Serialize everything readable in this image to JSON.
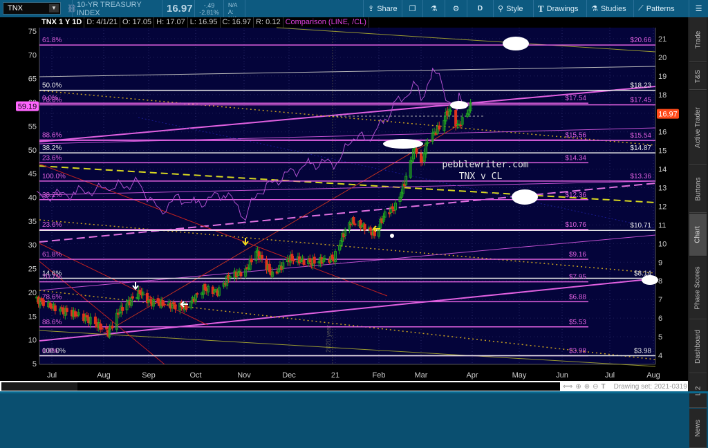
{
  "toolbar": {
    "symbol": "TNX",
    "description": "10-YR TREASURY INDEX",
    "last": "16.97",
    "change": "-.49",
    "change_pct": "-2.81%",
    "bid": "B: N/A",
    "ask": "A: N/A",
    "share": "Share",
    "aggregation": "D",
    "style": "Style",
    "drawings": "Drawings",
    "studies": "Studies",
    "patterns": "Patterns"
  },
  "infobar": {
    "title": "TNX 1 Y 1D",
    "date": "D: 4/1/21",
    "open": "O: 17.05",
    "high": "H: 17.07",
    "low": "L: 16.95",
    "close": "C: 16.97",
    "range": "R: 0.12",
    "comparison": "Comparison (LINE, /CL)"
  },
  "sidebar": {
    "tabs": [
      "Trade",
      "T&S",
      "Active Trader",
      "Buttons",
      "Chart",
      "Phase Scores",
      "Dashboard",
      "L 2",
      "News"
    ],
    "selected": "Chart"
  },
  "drawing_set": "Drawing set: 2021-0319",
  "annotation": {
    "line1": "pebblewriter.com",
    "line2": "TNX v CL",
    "year_marker": "2020 year"
  },
  "colors": {
    "bg": "#04043a",
    "up": "#1fa31f",
    "down": "#e0321e",
    "comparison": "#b050d0",
    "fib": "#e060e0",
    "white": "#e8e8e8",
    "price_badge": "#ff4a1a",
    "comp_badge": "#ff66ff"
  },
  "chart_data": {
    "type": "candlestick",
    "title": "TNX 1 Y 1D",
    "x_ticks": [
      "Jul",
      "Aug",
      "Sep",
      "Oct",
      "Nov",
      "Dec",
      "21",
      "Feb",
      "Mar",
      "Apr",
      "May",
      "Jun",
      "Jul",
      "Aug"
    ],
    "right_axis": {
      "label": "TNX",
      "range": [
        3.5,
        21.5
      ],
      "ticks": [
        4,
        5,
        6,
        7,
        8,
        9,
        10,
        11,
        12,
        13,
        14,
        15,
        16,
        17,
        18,
        19,
        20,
        21
      ]
    },
    "left_axis": {
      "label": "/CL",
      "range": [
        3,
        75
      ],
      "ticks": [
        5,
        10,
        15,
        20,
        25,
        30,
        35,
        40,
        45,
        50,
        55,
        60,
        65,
        70,
        75
      ]
    },
    "last_price": "16.97",
    "comparison_last": "59.19",
    "tnx_close": [
      [
        "2020-06-22",
        7.0
      ],
      [
        "2020-07-01",
        6.6
      ],
      [
        "2020-07-15",
        6.2
      ],
      [
        "2020-07-24",
        5.9
      ],
      [
        "2020-08-04",
        5.2
      ],
      [
        "2020-08-12",
        6.4
      ],
      [
        "2020-08-26",
        7.4
      ],
      [
        "2020-09-01",
        6.9
      ],
      [
        "2020-09-15",
        6.7
      ],
      [
        "2020-09-25",
        6.6
      ],
      [
        "2020-10-06",
        7.6
      ],
      [
        "2020-10-15",
        7.4
      ],
      [
        "2020-10-23",
        8.3
      ],
      [
        "2020-11-02",
        8.5
      ],
      [
        "2020-11-09",
        9.6
      ],
      [
        "2020-11-20",
        8.3
      ],
      [
        "2020-12-01",
        9.2
      ],
      [
        "2020-12-15",
        9.0
      ],
      [
        "2020-12-31",
        9.2
      ],
      [
        "2021-01-06",
        10.4
      ],
      [
        "2021-01-12",
        11.2
      ],
      [
        "2021-01-22",
        10.9
      ],
      [
        "2021-01-29",
        10.5
      ],
      [
        "2021-02-05",
        11.6
      ],
      [
        "2021-02-12",
        12.0
      ],
      [
        "2021-02-17",
        13.0
      ],
      [
        "2021-02-25",
        15.2
      ],
      [
        "2021-03-01",
        14.2
      ],
      [
        "2021-03-05",
        15.6
      ],
      [
        "2021-03-12",
        16.2
      ],
      [
        "2021-03-18",
        17.2
      ],
      [
        "2021-03-23",
        16.3
      ],
      [
        "2021-03-26",
        16.6
      ],
      [
        "2021-03-31",
        17.4
      ],
      [
        "2021-04-01",
        16.97
      ]
    ],
    "cl_close": [
      [
        "2020-06-22",
        40
      ],
      [
        "2020-07-15",
        41
      ],
      [
        "2020-08-05",
        42
      ],
      [
        "2020-08-25",
        43
      ],
      [
        "2020-09-08",
        37
      ],
      [
        "2020-09-20",
        40
      ],
      [
        "2020-10-01",
        38.5
      ],
      [
        "2020-10-20",
        41
      ],
      [
        "2020-11-02",
        36
      ],
      [
        "2020-11-10",
        41
      ],
      [
        "2020-11-30",
        45
      ],
      [
        "2020-12-15",
        47
      ],
      [
        "2021-01-04",
        47.5
      ],
      [
        "2021-01-12",
        52.5
      ],
      [
        "2021-01-27",
        52.5
      ],
      [
        "2021-02-05",
        56.5
      ],
      [
        "2021-02-12",
        59.5
      ],
      [
        "2021-02-25",
        63.5
      ],
      [
        "2021-03-01",
        61
      ],
      [
        "2021-03-08",
        66
      ],
      [
        "2021-03-12",
        65.6
      ],
      [
        "2021-03-18",
        60
      ],
      [
        "2021-03-23",
        57.8
      ],
      [
        "2021-03-24",
        61
      ],
      [
        "2021-03-31",
        59.19
      ]
    ],
    "fib_levels": [
      {
        "pct": "61.8%",
        "price": 20.66,
        "price_label": "$20.66",
        "full": true,
        "color": "#e060e0"
      },
      {
        "pct": "50.0%",
        "price": 18.23,
        "price_label": "$18.23",
        "full": true,
        "color": "#e8e8e8"
      },
      {
        "pct": "0.0%",
        "price": 17.54,
        "price_label": "$17.54",
        "full": false,
        "color": "#e060e0"
      },
      {
        "pct": "78.6%",
        "price": 17.45,
        "price_label": "$17.45",
        "full": true,
        "color": "#e060e0"
      },
      {
        "pct": "88.6%",
        "price": 15.56,
        "price_label": "$15.56",
        "full": false,
        "color": "#e060e0"
      },
      {
        "pct": "",
        "price": 15.54,
        "price_label": "$15.54",
        "full": true,
        "color": "#e060e0"
      },
      {
        "pct": "38.2%",
        "price": 14.87,
        "price_label": "$14.87",
        "full": true,
        "color": "#e8e8e8"
      },
      {
        "pct": "23.6%",
        "price": 14.34,
        "price_label": "$14.34",
        "full": false,
        "color": "#e060e0"
      },
      {
        "pct": "100.0%",
        "price": 13.36,
        "price_label": "$13.36",
        "full": true,
        "color": "#e060e0"
      },
      {
        "pct": "38.2%",
        "price": 12.36,
        "price_label": "$12.36",
        "full": false,
        "color": "#e060e0"
      },
      {
        "pct": "23.6%",
        "price": 10.76,
        "price_label": "$10.76",
        "full": false,
        "color": "#e060e0"
      },
      {
        "pct": "",
        "price": 10.71,
        "price_label": "$10.71",
        "full": true,
        "color": "#e8e8e8"
      },
      {
        "pct": "61.8%",
        "price": 9.16,
        "price_label": "$9.16",
        "full": false,
        "color": "#e060e0"
      },
      {
        "pct": "14.6%",
        "price": 8.14,
        "price_label": "$8.14",
        "full": true,
        "color": "#e8e8e8"
      },
      {
        "pct": "70.7%",
        "price": 7.95,
        "price_label": "$7.95",
        "full": false,
        "color": "#e060e0"
      },
      {
        "pct": "78.6%",
        "price": 6.88,
        "price_label": "$6.88",
        "full": false,
        "color": "#e060e0"
      },
      {
        "pct": "88.6%",
        "price": 5.53,
        "price_label": "$5.53",
        "full": false,
        "color": "#e060e0"
      },
      {
        "pct": "0.0%",
        "price": 3.98,
        "price_label": "$3.98",
        "full": false,
        "color": "#e060e0"
      },
      {
        "pct": "100.0%",
        "price": 3.98,
        "price_label": "$3.98",
        "full": true,
        "color": "#e8e8e8"
      }
    ]
  }
}
